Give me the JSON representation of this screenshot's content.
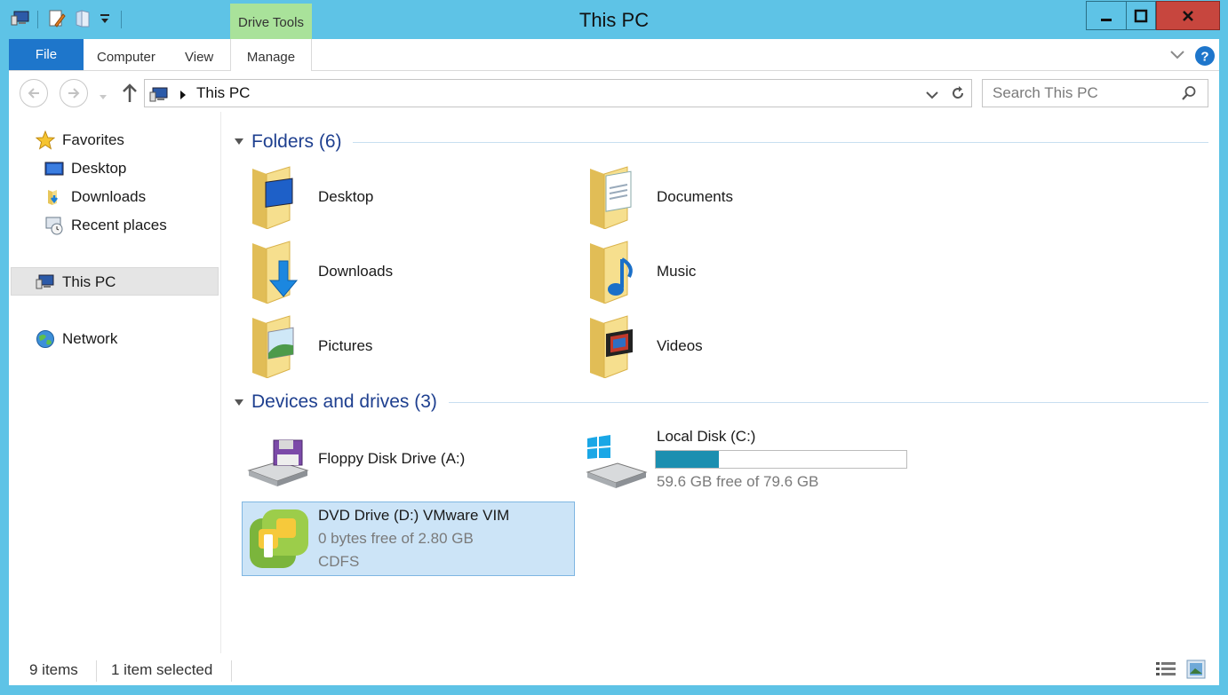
{
  "window": {
    "title": "This PC"
  },
  "ribbon": {
    "context_tab": "Drive Tools",
    "tabs": [
      "File",
      "Computer",
      "View",
      "Manage"
    ]
  },
  "address": {
    "breadcrumb": "This PC",
    "search_placeholder": "Search This PC"
  },
  "nav": {
    "favorites": "Favorites",
    "fav_items": [
      "Desktop",
      "Downloads",
      "Recent places"
    ],
    "this_pc": "This PC",
    "network": "Network"
  },
  "main": {
    "folders_header": "Folders (6)",
    "folders": [
      "Desktop",
      "Documents",
      "Downloads",
      "Music",
      "Pictures",
      "Videos"
    ],
    "devices_header": "Devices and drives (3)",
    "drives": {
      "floppy": {
        "name": "Floppy Disk Drive (A:)"
      },
      "local": {
        "name": "Local Disk (C:)",
        "free_text": "59.6 GB free of 79.6 GB",
        "used_fraction": 0.25
      },
      "dvd": {
        "name": "DVD Drive (D:) VMware VIM",
        "free_text": "0 bytes free of 2.80 GB",
        "fs": "CDFS"
      }
    }
  },
  "status": {
    "items": "9 items",
    "selected": "1 item selected"
  },
  "colors": {
    "accent": "#1e76cb",
    "titlebar": "#5ec3e6",
    "context_tab": "#a9e29a",
    "usage_bar": "#1b8fb0"
  }
}
